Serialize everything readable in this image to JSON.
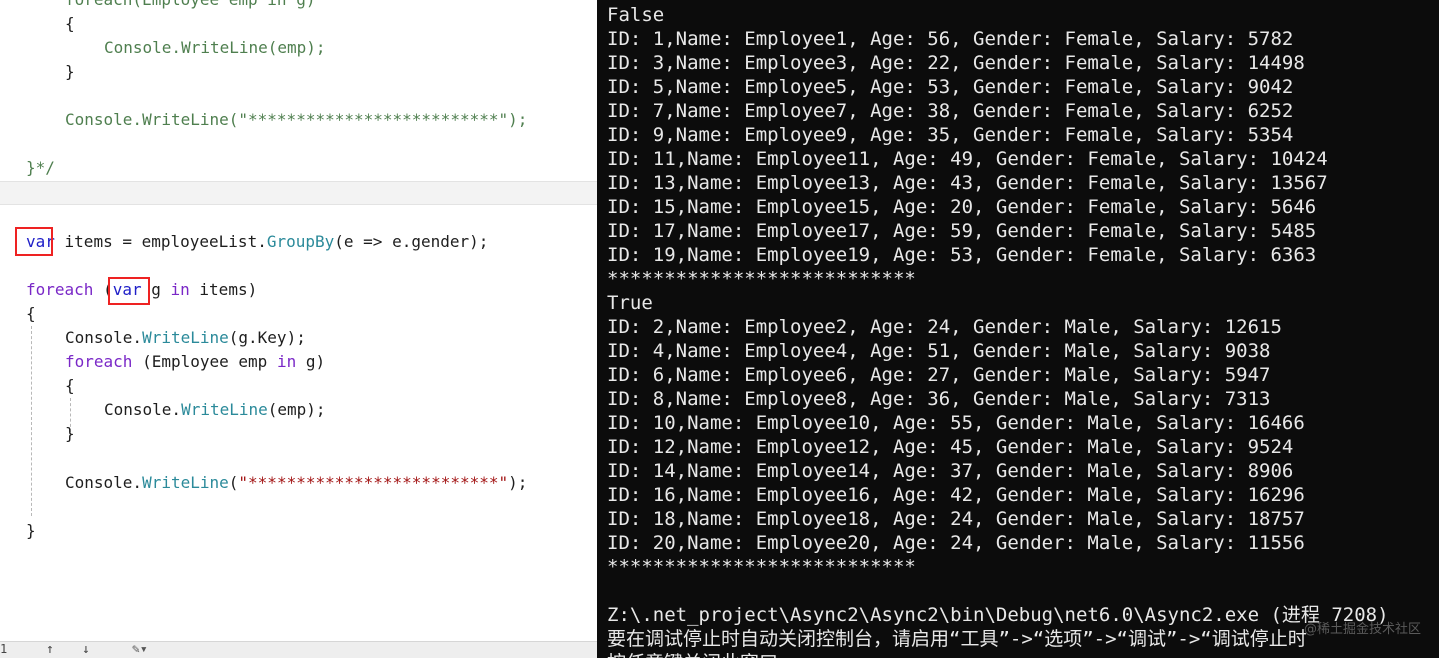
{
  "editor": {
    "top_lines": {
      "foreach_cut": "foreach(Employee emp in g)",
      "open_brace": "{",
      "writeline_emp": "Console.WriteLine(emp);",
      "close_brace": "}",
      "writeline_stars": "Console.WriteLine(\"**************************\");",
      "end_comment": "}*/"
    },
    "code": {
      "var_kw": "var",
      "items_decl": " items = employeeList.",
      "groupby": "GroupBy",
      "lambda": "(e => e.gender);",
      "foreach_kw": "foreach",
      "paren_open": " (",
      "var_kw2": "var",
      "g_in": " g ",
      "in_kw": "in",
      "items_close": " items)",
      "brace_open": "{",
      "console1": "Console.",
      "writeline1": "WriteLine",
      "gkey": "(g.Key);",
      "foreach_kw2": "foreach",
      "emp_loop_a": " (Employee emp ",
      "in_kw2": "in",
      "emp_loop_b": " g)",
      "inner_open": "{",
      "console2": "Console.",
      "writeline2": "WriteLine",
      "emp_arg": "(emp);",
      "inner_close": "}",
      "console3": "Console.",
      "writeline3": "WriteLine",
      "star_open": "(",
      "stars": "\"**************************\"",
      "star_close": ");",
      "brace_close": "}"
    },
    "status": {
      "line_no": "1",
      "up_arrow": "↑",
      "down_arrow": "↓",
      "brush": "✎▾"
    }
  },
  "console": {
    "lines": [
      "False",
      "ID: 1,Name: Employee1, Age: 56, Gender: Female, Salary: 5782",
      "ID: 3,Name: Employee3, Age: 22, Gender: Female, Salary: 14498",
      "ID: 5,Name: Employee5, Age: 53, Gender: Female, Salary: 9042",
      "ID: 7,Name: Employee7, Age: 38, Gender: Female, Salary: 6252",
      "ID: 9,Name: Employee9, Age: 35, Gender: Female, Salary: 5354",
      "ID: 11,Name: Employee11, Age: 49, Gender: Female, Salary: 10424",
      "ID: 13,Name: Employee13, Age: 43, Gender: Female, Salary: 13567",
      "ID: 15,Name: Employee15, Age: 20, Gender: Female, Salary: 5646",
      "ID: 17,Name: Employee17, Age: 59, Gender: Female, Salary: 5485",
      "ID: 19,Name: Employee19, Age: 53, Gender: Female, Salary: 6363",
      "***************************",
      "True",
      "ID: 2,Name: Employee2, Age: 24, Gender: Male, Salary: 12615",
      "ID: 4,Name: Employee4, Age: 51, Gender: Male, Salary: 9038",
      "ID: 6,Name: Employee6, Age: 27, Gender: Male, Salary: 5947",
      "ID: 8,Name: Employee8, Age: 36, Gender: Male, Salary: 7313",
      "ID: 10,Name: Employee10, Age: 55, Gender: Male, Salary: 16466",
      "ID: 12,Name: Employee12, Age: 45, Gender: Male, Salary: 9524",
      "ID: 14,Name: Employee14, Age: 37, Gender: Male, Salary: 8906",
      "ID: 16,Name: Employee16, Age: 42, Gender: Male, Salary: 16296",
      "ID: 18,Name: Employee18, Age: 24, Gender: Male, Salary: 18757",
      "ID: 20,Name: Employee20, Age: 24, Gender: Male, Salary: 11556",
      "***************************",
      "",
      "Z:\\.net_project\\Async2\\Async2\\bin\\Debug\\net6.0\\Async2.exe (进程 7208)",
      "要在调试停止时自动关闭控制台，请启用“工具”->“选项”->“调试”->“调试停止时",
      "按任意键关闭此窗口. . ."
    ],
    "watermark": "@稀土掘金技术社区"
  }
}
